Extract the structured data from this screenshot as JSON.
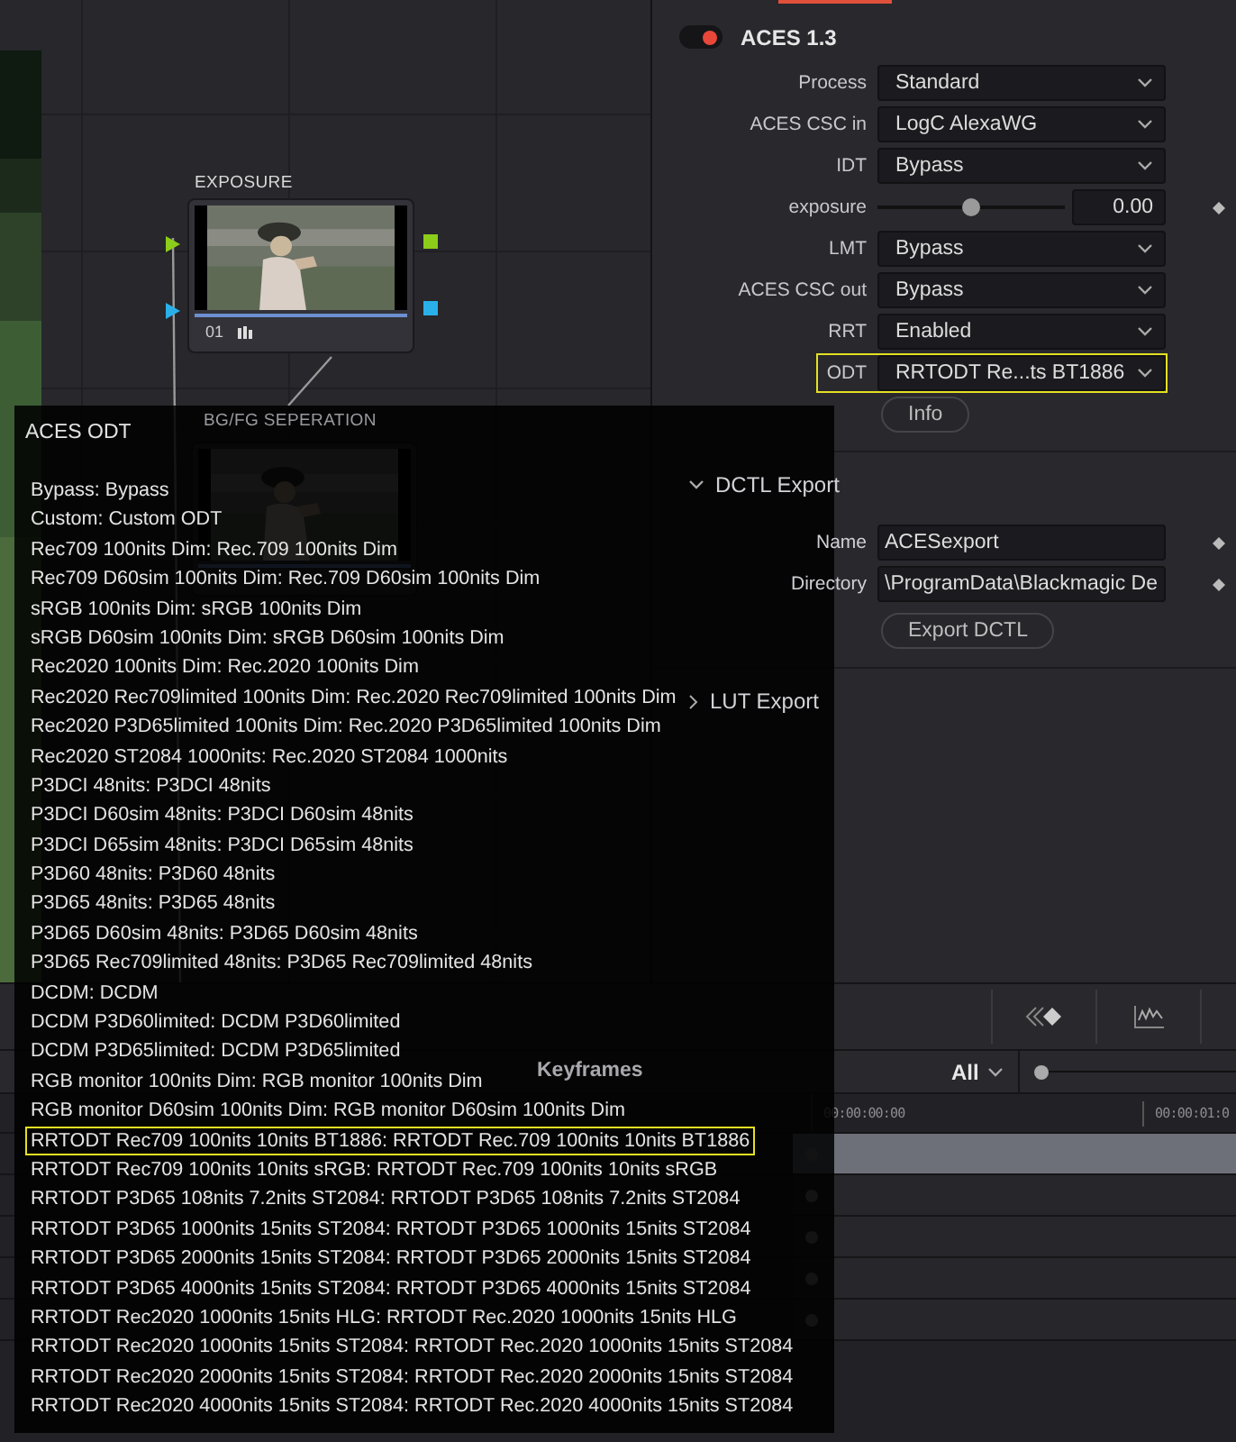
{
  "nodes": [
    {
      "label": "EXPOSURE",
      "number": "01"
    },
    {
      "label": "BG/FG SEPERATION"
    }
  ],
  "aces_panel": {
    "title": "ACES 1.3",
    "enabled": true,
    "fields": [
      {
        "kind": "select",
        "label": "Process",
        "value": "Standard",
        "highlighted": false
      },
      {
        "kind": "select",
        "label": "ACES CSC in",
        "value": "LogC AlexaWG",
        "highlighted": false
      },
      {
        "kind": "select",
        "label": "IDT",
        "value": "Bypass",
        "highlighted": false
      },
      {
        "kind": "slider",
        "label": "exposure",
        "value": "0.00",
        "level": 0.5,
        "highlighted": false
      },
      {
        "kind": "select",
        "label": "LMT",
        "value": "Bypass",
        "highlighted": false
      },
      {
        "kind": "select",
        "label": "ACES CSC out",
        "value": "Bypass",
        "highlighted": false
      },
      {
        "kind": "select",
        "label": "RRT",
        "value": "Enabled",
        "highlighted": false
      },
      {
        "kind": "select",
        "label": "ODT",
        "value": "RRTODT Re...ts BT1886",
        "highlighted": true
      }
    ],
    "info_button": "Info"
  },
  "dctl_export": {
    "title": "DCTL Export",
    "expanded": true,
    "name_label": "Name",
    "name_value": "ACESexport",
    "directory_label": "Directory",
    "directory_value": "\\ProgramData\\Blackmagic De",
    "button": "Export DCTL"
  },
  "lut_export": {
    "title": "LUT Export",
    "expanded": false
  },
  "keyframes": {
    "title": "Keyframes",
    "filter": "All",
    "zoom": {
      "level": 0
    },
    "timecodes": [
      "00:00:00:00",
      "00:00:01:0"
    ],
    "rows": [
      {
        "selected": true
      },
      {
        "selected": false
      },
      {
        "selected": false
      },
      {
        "selected": false
      },
      {
        "selected": false
      }
    ]
  },
  "tooltip": {
    "title": "ACES ODT",
    "items": [
      {
        "text": "Bypass: Bypass",
        "selected": false
      },
      {
        "text": "Custom: Custom ODT",
        "selected": false
      },
      {
        "text": "Rec709 100nits Dim: Rec.709 100nits Dim",
        "selected": false
      },
      {
        "text": "Rec709 D60sim 100nits Dim: Rec.709 D60sim 100nits Dim",
        "selected": false
      },
      {
        "text": "sRGB 100nits Dim: sRGB 100nits Dim",
        "selected": false
      },
      {
        "text": "sRGB D60sim 100nits Dim: sRGB D60sim 100nits Dim",
        "selected": false
      },
      {
        "text": "Rec2020 100nits Dim: Rec.2020 100nits Dim",
        "selected": false
      },
      {
        "text": "Rec2020 Rec709limited 100nits Dim: Rec.2020 Rec709limited 100nits Dim",
        "selected": false
      },
      {
        "text": "Rec2020 P3D65limited 100nits Dim: Rec.2020 P3D65limited 100nits Dim",
        "selected": false
      },
      {
        "text": "Rec2020 ST2084 1000nits: Rec.2020 ST2084 1000nits",
        "selected": false
      },
      {
        "text": "P3DCI 48nits: P3DCI 48nits",
        "selected": false
      },
      {
        "text": "P3DCI D60sim 48nits: P3DCI D60sim 48nits",
        "selected": false
      },
      {
        "text": "P3DCI D65sim 48nits: P3DCI D65sim 48nits",
        "selected": false
      },
      {
        "text": "P3D60 48nits: P3D60 48nits",
        "selected": false
      },
      {
        "text": "P3D65 48nits: P3D65 48nits",
        "selected": false
      },
      {
        "text": "P3D65 D60sim 48nits: P3D65 D60sim 48nits",
        "selected": false
      },
      {
        "text": "P3D65 Rec709limited 48nits: P3D65 Rec709limited 48nits",
        "selected": false
      },
      {
        "text": "DCDM: DCDM",
        "selected": false
      },
      {
        "text": "DCDM P3D60limited: DCDM P3D60limited",
        "selected": false
      },
      {
        "text": "DCDM P3D65limited: DCDM P3D65limited",
        "selected": false
      },
      {
        "text": "RGB monitor 100nits Dim: RGB monitor 100nits Dim",
        "selected": false
      },
      {
        "text": "RGB monitor D60sim 100nits Dim: RGB monitor D60sim 100nits Dim",
        "selected": false
      },
      {
        "text": "RRTODT Rec709 100nits 10nits BT1886: RRTODT Rec.709 100nits 10nits BT1886",
        "selected": true
      },
      {
        "text": "RRTODT Rec709 100nits 10nits sRGB: RRTODT Rec.709 100nits 10nits sRGB",
        "selected": false
      },
      {
        "text": "RRTODT P3D65 108nits 7.2nits ST2084: RRTODT P3D65 108nits 7.2nits ST2084",
        "selected": false
      },
      {
        "text": "RRTODT P3D65 1000nits 15nits ST2084: RRTODT P3D65 1000nits 15nits ST2084",
        "selected": false
      },
      {
        "text": "RRTODT P3D65 2000nits 15nits ST2084: RRTODT P3D65 2000nits 15nits ST2084",
        "selected": false
      },
      {
        "text": "RRTODT P3D65 4000nits 15nits ST2084: RRTODT P3D65 4000nits 15nits ST2084",
        "selected": false
      },
      {
        "text": "RRTODT Rec2020 1000nits 15nits HLG: RRTODT Rec.2020 1000nits 15nits HLG",
        "selected": false
      },
      {
        "text": "RRTODT Rec2020 1000nits 15nits ST2084: RRTODT Rec.2020 1000nits 15nits ST2084",
        "selected": false
      },
      {
        "text": "RRTODT Rec2020 2000nits 15nits ST2084: RRTODT Rec.2020 2000nits 15nits ST2084",
        "selected": false
      },
      {
        "text": "RRTODT Rec2020 4000nits 15nits ST2084: RRTODT Rec.2020 4000nits 15nits ST2084",
        "selected": false
      }
    ]
  }
}
